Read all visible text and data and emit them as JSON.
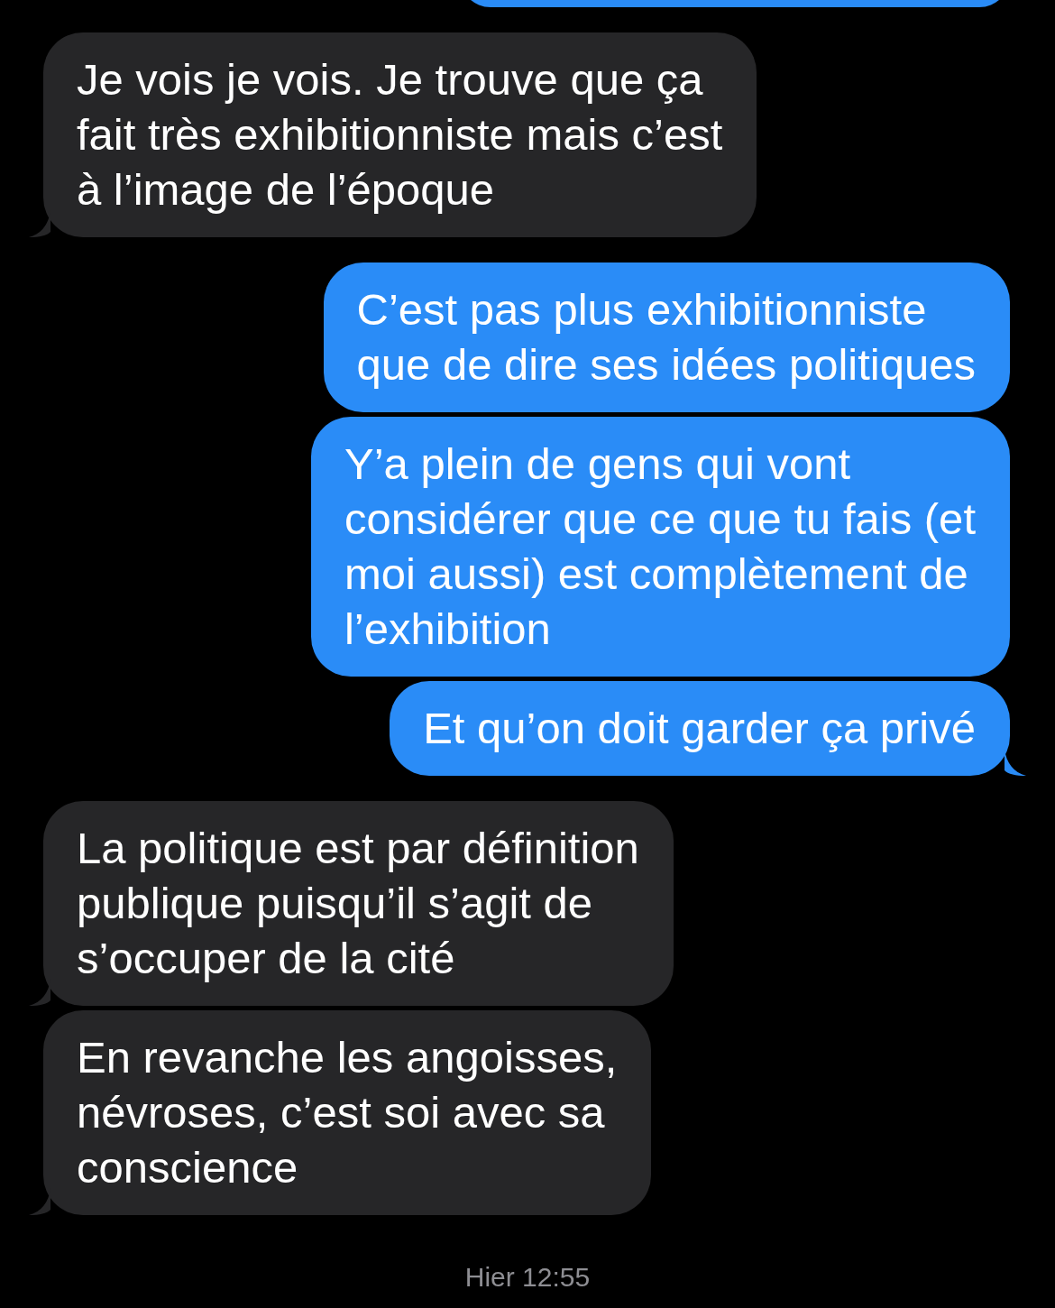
{
  "messages": [
    {
      "kind": "received",
      "tail": true,
      "lines": [
        "Je vois je vois. Je trouve que ça",
        "fait très exhibitionniste mais c’est",
        "à l’image de l’époque"
      ]
    },
    {
      "kind": "sent",
      "tail": false,
      "lines": [
        "C’est pas plus exhibitionniste",
        "que de dire ses idées politiques"
      ]
    },
    {
      "kind": "sent",
      "tail": false,
      "lines": [
        "Y’a plein de gens qui vont",
        "considérer que ce que tu fais (et",
        "moi aussi) est complètement de",
        "l’exhibition"
      ]
    },
    {
      "kind": "sent",
      "tail": true,
      "lines": [
        "Et qu’on doit garder ça privé"
      ]
    },
    {
      "kind": "received",
      "tail": true,
      "lines": [
        "La politique est par définition",
        "publique puisqu’il s’agit de",
        "s’occuper de la cité"
      ]
    },
    {
      "kind": "received",
      "tail": true,
      "lines": [
        "En revanche les angoisses,",
        "névroses, c’est soi avec sa",
        "conscience"
      ]
    }
  ],
  "timestamp": "Hier 12:55"
}
